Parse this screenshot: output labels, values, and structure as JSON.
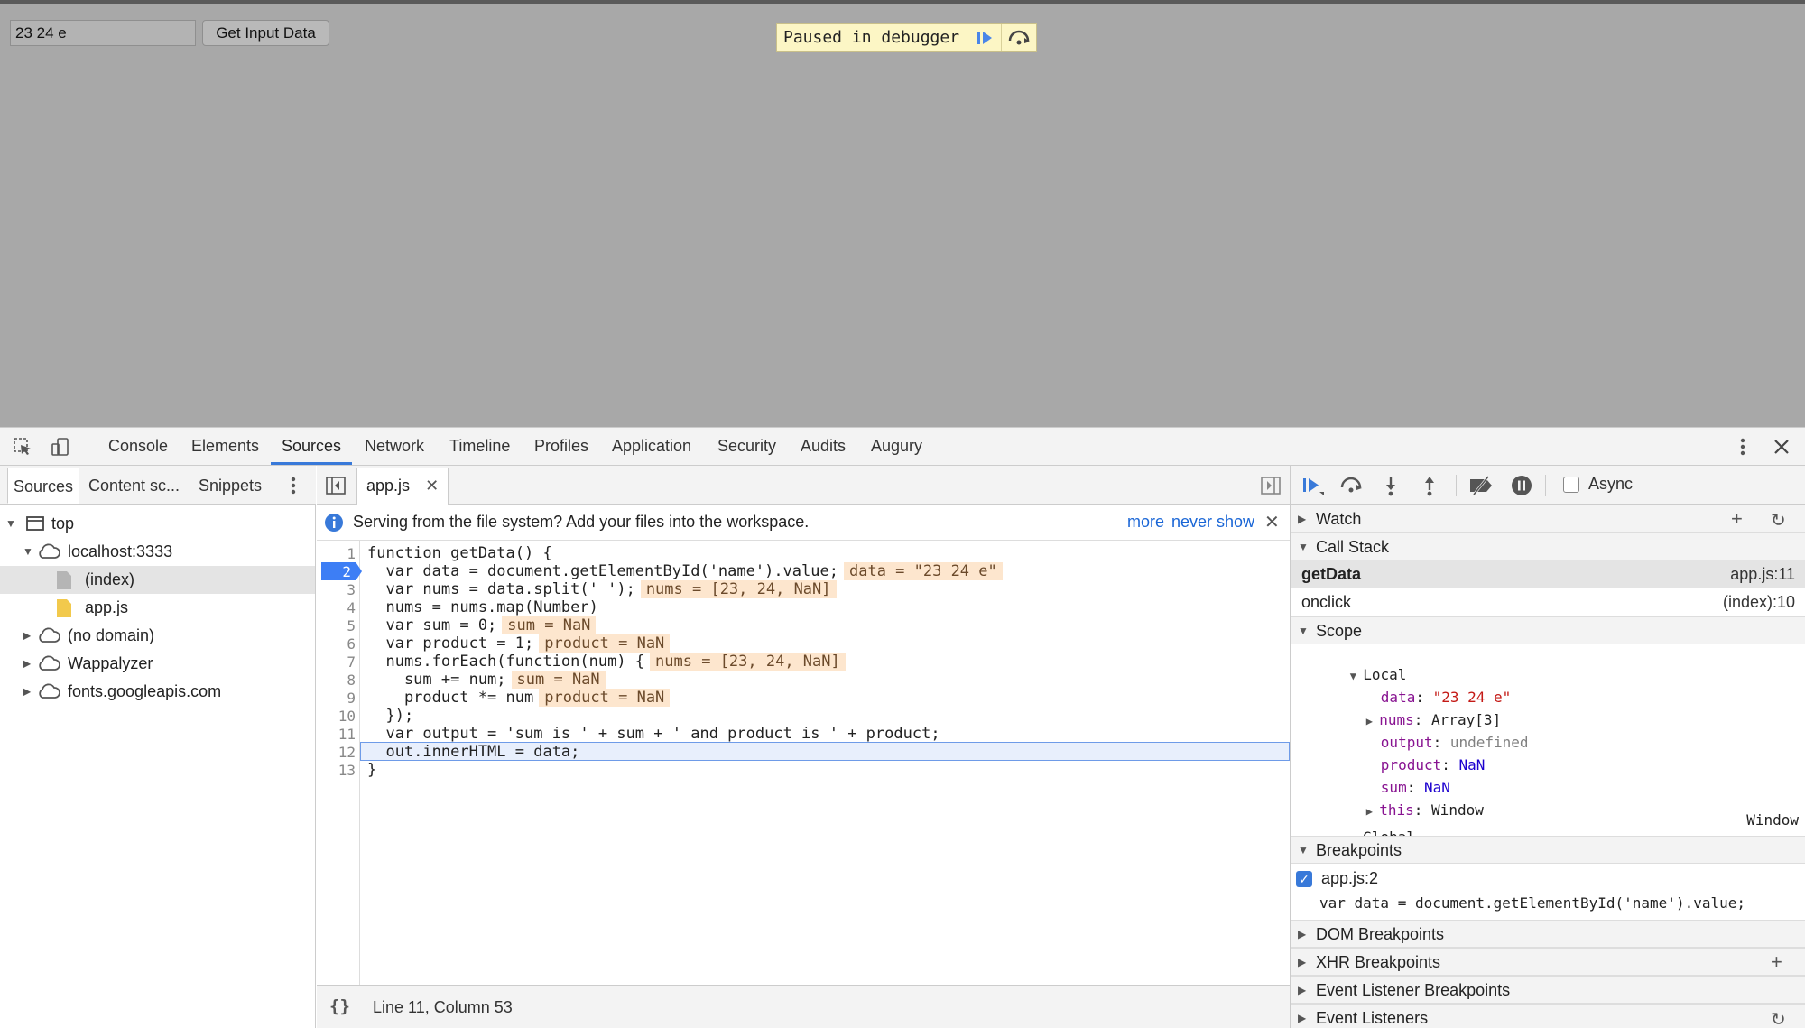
{
  "page": {
    "input_value": "23 24 e",
    "button_label": "Get Input Data",
    "paused_message": "Paused in debugger"
  },
  "devtools": {
    "tabs": [
      "Console",
      "Elements",
      "Sources",
      "Network",
      "Timeline",
      "Profiles",
      "Application",
      "Security",
      "Audits",
      "Augury"
    ],
    "active_tab": "Sources",
    "navigator": {
      "tabs": [
        "Sources",
        "Content sc...",
        "Snippets"
      ],
      "tree": {
        "top": "top",
        "host": "localhost:3333",
        "index": "(index)",
        "appjs": "app.js",
        "no_domain": "(no domain)",
        "wappalyzer": "Wappalyzer",
        "fonts": "fonts.googleapis.com"
      }
    },
    "editor": {
      "file_tab": "app.js",
      "infobar_message": "Serving from the file system? Add your files into the workspace.",
      "infobar_more": "more",
      "infobar_never": "never show",
      "line_numbers": [
        "1",
        "2",
        "3",
        "4",
        "5",
        "6",
        "7",
        "8",
        "9",
        "10",
        "11",
        "12",
        "13"
      ],
      "breakpoint_line": "2",
      "code": {
        "l1": "function getData() {",
        "l2_code": "  var data = document.getElementById('name').value;",
        "l2_inline": "data = \"23 24 e\"",
        "l3_code": "  var nums = data.split(' ');",
        "l3_inline": "nums = [23, 24, NaN]",
        "l4": "  nums = nums.map(Number)",
        "l5_code": "  var sum = 0;",
        "l5_inline": "sum = NaN",
        "l6_code": "  var product = 1;",
        "l6_inline": "product = NaN",
        "l7_code": "  nums.forEach(function(num) {",
        "l7_inline": "nums = [23, 24, NaN]",
        "l8_code": "    sum += num;",
        "l8_inline": "sum = NaN",
        "l9_code": "    product *= num",
        "l9_inline": "product = NaN",
        "l10": "  });",
        "l11": "  var output = 'sum is ' + sum + ' and product is ' + product;",
        "l12": "  out.innerHTML = data;",
        "l13": "}"
      },
      "status": "Line 11, Column 53"
    },
    "debugger": {
      "async_label": "Async",
      "watch": "Watch",
      "call_stack": "Call Stack",
      "frames": [
        {
          "fn": "getData",
          "loc": "app.js:11"
        },
        {
          "fn": "onclick",
          "loc": "(index):10"
        }
      ],
      "scope": "Scope",
      "local": "Local",
      "local_vars": {
        "data_name": "data",
        "data_value": "\"23 24 e\"",
        "nums_name": "nums",
        "nums_value": "Array[3]",
        "output_name": "output",
        "output_value": "undefined",
        "product_name": "product",
        "product_value": "NaN",
        "sum_name": "sum",
        "sum_value": "NaN",
        "this_name": "this",
        "this_value": "Window"
      },
      "global": "Global",
      "global_value": "Window",
      "breakpoints": "Breakpoints",
      "breakpoint_file": "app.js:2",
      "breakpoint_code": "var data = document.getElementById('name').value;",
      "dom_breakpoints": "DOM Breakpoints",
      "xhr_breakpoints": "XHR Breakpoints",
      "event_listener_breakpoints": "Event Listener Breakpoints",
      "event_listeners": "Event Listeners"
    }
  },
  "colors": {
    "accent": "#3879d9",
    "breakpoint": "#3d7ef5",
    "paused_bg": "#fcf6c5",
    "inline_value_bg": "#fde6ce"
  }
}
